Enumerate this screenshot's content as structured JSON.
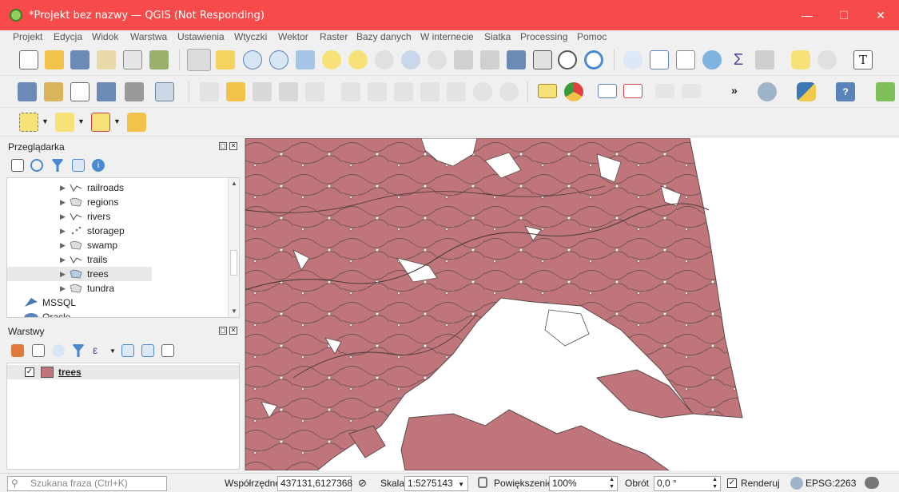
{
  "window": {
    "title": "*Projekt bez nazwy — QGIS (Not Responding)",
    "minimize": "—",
    "maximize": "☐",
    "close": "✕",
    "titlebar_color": "#f74a4a"
  },
  "menu": [
    "Projekt",
    "Edycja",
    "Widok",
    "Warstwa",
    "Ustawienia",
    "Wtyczki",
    "Wektor",
    "Raster",
    "Bazy danych",
    "W internecie",
    "Siatka",
    "Processing",
    "Pomoc"
  ],
  "toolbar": {
    "overflow": "»"
  },
  "browser_panel": {
    "title": "Przeglądarka",
    "items": [
      {
        "label": "railroads",
        "icon": "line-layer-icon"
      },
      {
        "label": "regions",
        "icon": "polygon-layer-icon"
      },
      {
        "label": "rivers",
        "icon": "line-layer-icon"
      },
      {
        "label": "storagep",
        "icon": "point-layer-icon"
      },
      {
        "label": "swamp",
        "icon": "polygon-layer-icon"
      },
      {
        "label": "trails",
        "icon": "line-layer-icon"
      },
      {
        "label": "trees",
        "icon": "polygon-layer-icon",
        "selected": true
      },
      {
        "label": "tundra",
        "icon": "polygon-layer-icon"
      }
    ],
    "top_items": [
      {
        "label": "MSSQL",
        "icon": "mssql-icon"
      },
      {
        "label": "Oracle",
        "icon": "oracle-icon"
      }
    ]
  },
  "layers_panel": {
    "title": "Warstwy",
    "layers": [
      {
        "name": "trees",
        "checked": true,
        "color": "#c0757a"
      }
    ]
  },
  "map": {
    "fill_color": "#c0757a",
    "stroke_color": "#5a4a4a"
  },
  "status": {
    "search_placeholder": "Szukana fraza (Ctrl+K)",
    "coord_label": "Współrzędne",
    "coord_value": "437131,6127368",
    "scale_label": "Skala",
    "scale_value": "1:5275143",
    "zoom_label": "Powiększenie",
    "zoom_value": "100%",
    "rotation_label": "Obrót",
    "rotation_value": "0,0 °",
    "render_label": "Renderuj",
    "render_checked": true,
    "crs": "EPSG:2263"
  }
}
